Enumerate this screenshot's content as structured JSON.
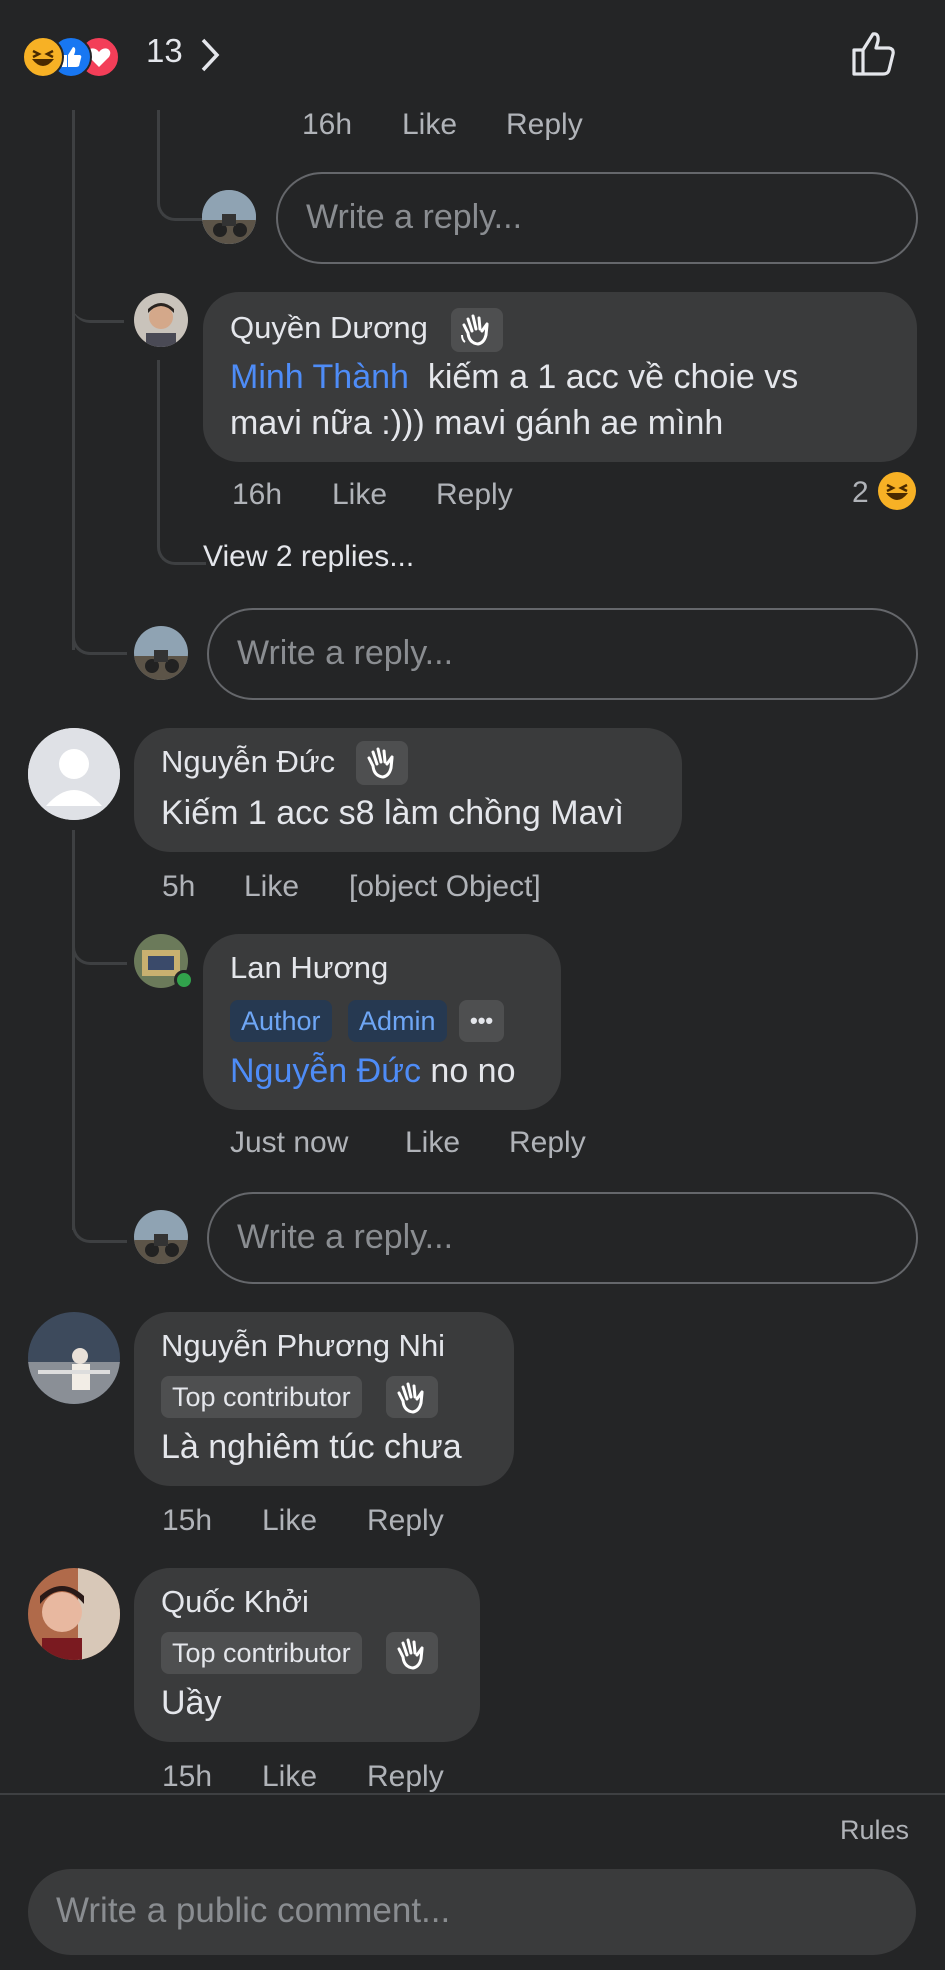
{
  "header": {
    "reactions": [
      "laugh-reaction",
      "like-reaction",
      "love-reaction"
    ],
    "reaction_count": "13",
    "like_icon": "thumbs-up-outline-icon"
  },
  "thread": {
    "top_meta": {
      "time": "16h",
      "like": "Like",
      "reply": "Reply"
    },
    "reply_input_1": "Write a reply...",
    "comment_quyen": {
      "name": "Quyền Dương",
      "mention": "Minh Thành",
      "text_line1": "kiếm a 1 acc về choie vs",
      "text_line2": "mavi nữa :))) mavi gánh ae mình",
      "time": "16h",
      "like": "Like",
      "reply": "Reply",
      "reaction_count": "2",
      "reaction_icon": "laugh-reaction"
    },
    "view_replies": "View 2 replies...",
    "reply_input_2": "Write a reply..."
  },
  "comment_duc": {
    "name": "Nguyễn Đức",
    "text": "Kiếm 1 acc s8 làm chồng Mavì",
    "time": "5h",
    "like": "Like",
    "reply": {
      "name": "Lan Hương",
      "badges": [
        "Author",
        "Admin"
      ],
      "more": "•••",
      "mention": "Nguyễn Đức",
      "text": "no no",
      "time": "Just now",
      "like": "Like",
      "reply_label": "Reply"
    },
    "reply_input": "Write a reply..."
  },
  "comment_nhi": {
    "name": "Nguyễn Phương Nhi",
    "badge": "Top contributor",
    "text": "Là nghiêm túc chưa",
    "time": "15h",
    "like": "Like",
    "reply": "Reply"
  },
  "comment_khoi": {
    "name": "Quốc Khởi",
    "badge": "Top contributor",
    "text": "Uầy",
    "time": "15h",
    "like": "Like",
    "reply": "Reply"
  },
  "footer": {
    "rules": "Rules",
    "public_comment_placeholder": "Write a public comment..."
  },
  "colors": {
    "background": "#242526",
    "bubble": "#3a3b3c",
    "mention": "#4e8cf7",
    "online": "#31a24c"
  }
}
